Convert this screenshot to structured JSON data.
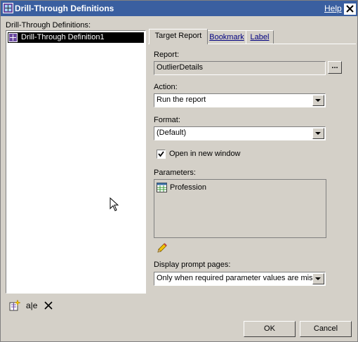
{
  "window": {
    "title": "Drill-Through Definitions",
    "help_label": "Help",
    "close_label": "×"
  },
  "left": {
    "label": "Drill-Through Definitions:",
    "items": [
      {
        "label": "Drill-Through Definition1",
        "selected": true
      }
    ]
  },
  "toolbar": {
    "items": [
      "new-definition",
      "rename-definition",
      "delete-definition"
    ],
    "rename_glyph": "a|e",
    "delete_glyph": "✕"
  },
  "tabs": [
    {
      "label": "Target Report",
      "active": true
    },
    {
      "label": "Bookmark",
      "active": false
    },
    {
      "label": "Label",
      "active": false
    }
  ],
  "form": {
    "report_label": "Report:",
    "report_value": "OutlierDetails",
    "browse_label": "...",
    "action_label": "Action:",
    "action_value": "Run the report",
    "format_label": "Format:",
    "format_value": "(Default)",
    "open_new_window_label": "Open in new window",
    "open_new_window_checked": true,
    "parameters_label": "Parameters:",
    "parameters": [
      "Profession"
    ],
    "prompt_label": "Display prompt pages:",
    "prompt_value": "Only when required parameter values are missing"
  },
  "buttons": {
    "ok": "OK",
    "cancel": "Cancel"
  },
  "colors": {
    "titlebar": "#3a5fa0",
    "dialog_bg": "#d4d0c8",
    "selection": "#000000"
  }
}
